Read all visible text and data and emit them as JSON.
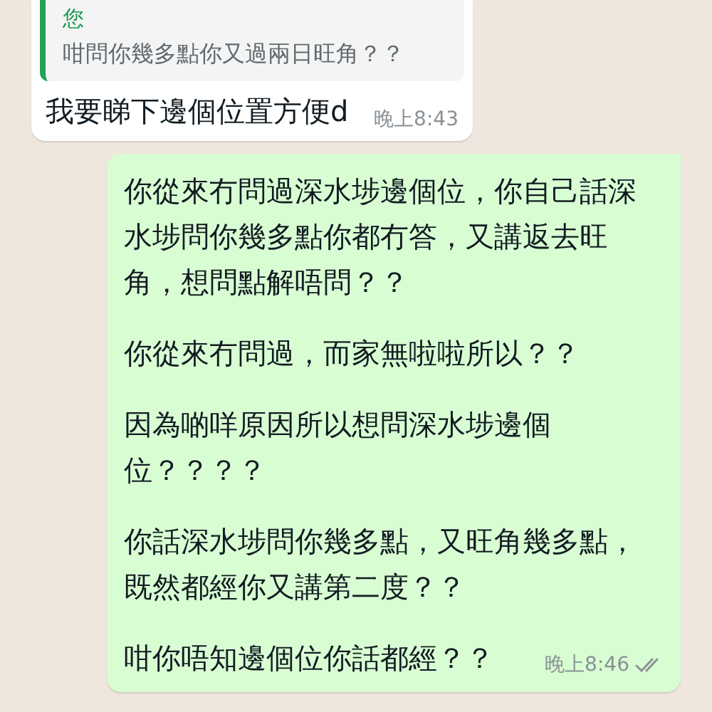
{
  "messages": [
    {
      "kind": "incoming",
      "quote": {
        "sender": "您",
        "text": "咁問你幾多點你又過兩日旺角？？"
      },
      "text": "我要睇下邊個位置方便d",
      "time": "晚上8:43"
    },
    {
      "kind": "outgoing",
      "paragraphs": [
        "你從來冇問過深水埗邊個位，你自己話深水埗問你幾多點你都冇答，又講返去旺角，想問點解唔問？？",
        "你從來冇問過，而家無啦啦所以？？",
        "因為啲咩原因所以想問深水埗邊個位？？？？",
        "你話深水埗問你幾多點，又旺角幾多點，既然都經你又講第二度？？",
        "咁你唔知邊個位你話都經？？"
      ],
      "time": "晚上8:46",
      "read": false
    }
  ]
}
